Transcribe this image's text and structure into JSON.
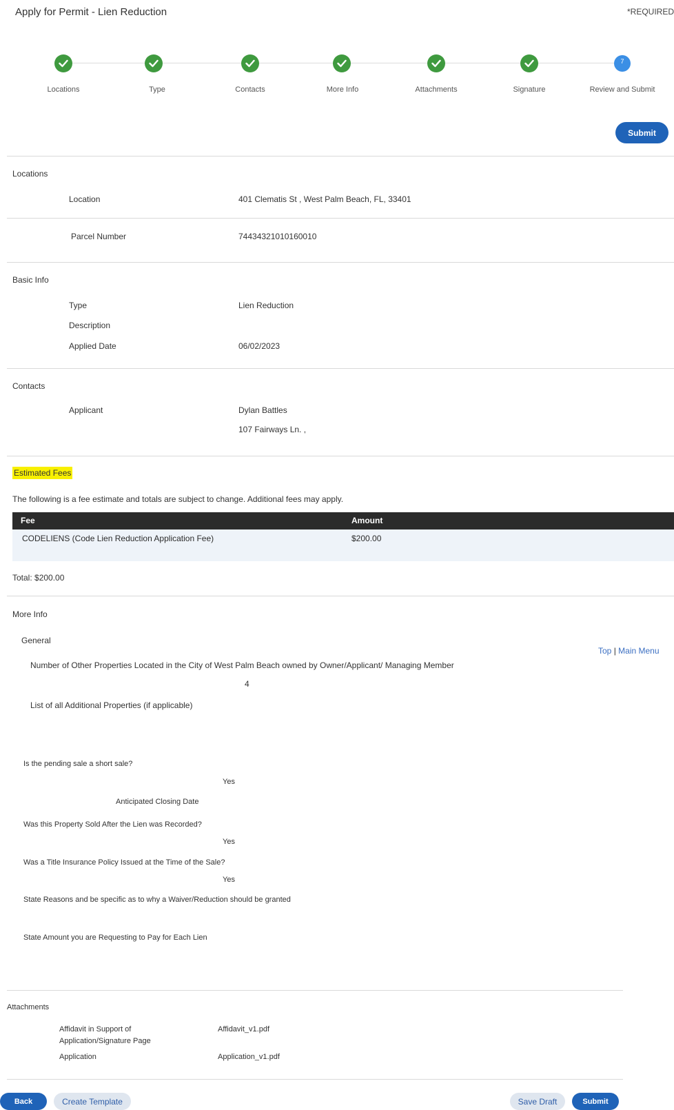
{
  "header": {
    "title": "Apply for Permit - Lien Reduction",
    "required": "*REQUIRED"
  },
  "steps": [
    {
      "label": "Locations",
      "status": "complete"
    },
    {
      "label": "Type",
      "status": "complete"
    },
    {
      "label": "Contacts",
      "status": "complete"
    },
    {
      "label": "More Info",
      "status": "complete"
    },
    {
      "label": "Attachments",
      "status": "complete"
    },
    {
      "label": "Signature",
      "status": "complete"
    },
    {
      "label": "Review and Submit",
      "status": "current",
      "number": "7"
    }
  ],
  "buttons": {
    "submit": "Submit",
    "back": "Back",
    "create_template": "Create Template",
    "save_draft": "Save Draft"
  },
  "locations": {
    "heading": "Locations",
    "location_label": "Location",
    "location_value": "401 Clematis St , West Palm Beach, FL, 33401",
    "parcel_label": "Parcel Number",
    "parcel_value": "74434321010160010"
  },
  "basic_info": {
    "heading": "Basic Info",
    "type_label": "Type",
    "type_value": "Lien Reduction",
    "description_label": "Description",
    "applied_date_label": "Applied Date",
    "applied_date_value": "06/02/2023"
  },
  "contacts": {
    "heading": "Contacts",
    "applicant_label": "Applicant",
    "applicant_name": "Dylan Battles",
    "applicant_address": "107 Fairways Ln. ,"
  },
  "fees": {
    "heading": "Estimated Fees",
    "note": "The following is a fee estimate and totals are subject to change. Additional fees may apply.",
    "columns": [
      "Fee",
      "Amount"
    ],
    "rows": [
      {
        "fee": "CODELIENS (Code Lien Reduction Application Fee)",
        "amount": "$200.00"
      }
    ],
    "total": "Total: $200.00"
  },
  "more_info": {
    "heading": "More Info",
    "general": "General",
    "links": {
      "top": "Top",
      "sep": "|",
      "main_menu": "Main Menu"
    },
    "q_properties": "Number of Other Properties Located in the City of West Palm Beach owned by Owner/Applicant/ Managing Member",
    "a_properties": "4",
    "q_list": "List of all Additional Properties (if applicable)",
    "q_short_sale": "Is the pending sale a short sale?",
    "a_short_sale": "Yes",
    "q_closing": "Anticipated Closing Date",
    "q_sold_after": "Was this Property Sold After the Lien was Recorded?",
    "a_sold_after": "Yes",
    "q_title_ins": "Was a Title Insurance Policy Issued at the Time of the Sale?",
    "a_title_ins": "Yes",
    "q_reasons": "State Reasons and be specific as to why a Waiver/Reduction should be granted",
    "q_amount": "State Amount you are Requesting to Pay for Each Lien"
  },
  "attachments": {
    "heading": "Attachments",
    "items": [
      {
        "label_line1": "Affidavit in Support of",
        "label_line2": "Application/Signature Page",
        "file": "Affidavit_v1.pdf"
      },
      {
        "label_line1": "Application",
        "file": "Application_v1.pdf"
      }
    ]
  },
  "colors": {
    "check_green": "#3f9a3f",
    "current_blue": "#3b8fe5",
    "primary_button": "#1f63b8",
    "highlight": "#f8f000"
  }
}
